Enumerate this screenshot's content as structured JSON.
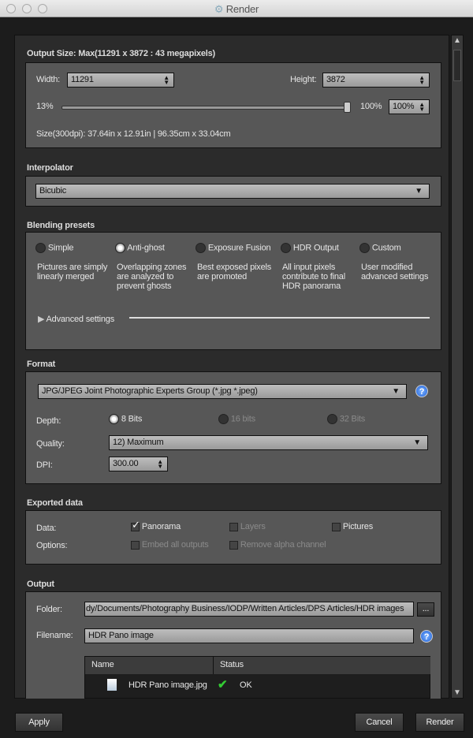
{
  "window": {
    "title": "Render"
  },
  "output_size": {
    "header": "Output Size: Max(11291 x 3872 : 43 megapixels)",
    "width_label": "Width:",
    "width": "11291",
    "height_label": "Height:",
    "height": "3872",
    "min_label": "13%",
    "max_label": "100%",
    "scale": "100%",
    "scale_percent": 100,
    "size_info": "Size(300dpi): 37.64in x 12.91in | 96.35cm x 33.04cm"
  },
  "interpolator": {
    "header": "Interpolator",
    "value": "Bicubic"
  },
  "blending": {
    "header": "Blending presets",
    "presets": [
      {
        "label": "Simple",
        "desc": "Pictures are simply linearly merged",
        "selected": false
      },
      {
        "label": "Anti-ghost",
        "desc": "Overlapping zones are analyzed to prevent ghosts",
        "selected": true
      },
      {
        "label": "Exposure Fusion",
        "desc": "Best exposed pixels are promoted",
        "selected": false
      },
      {
        "label": "HDR Output",
        "desc": "All input pixels contribute to final HDR panorama",
        "selected": false
      },
      {
        "label": "Custom",
        "desc": "User modified advanced settings",
        "selected": false
      }
    ],
    "advanced": "Advanced settings"
  },
  "format": {
    "header": "Format",
    "value": "JPG/JPEG Joint Photographic Experts Group (*.jpg *.jpeg)",
    "depth_label": "Depth:",
    "depths": [
      "8 Bits",
      "16 bits",
      "32 Bits"
    ],
    "quality_label": "Quality:",
    "quality": "12) Maximum",
    "dpi_label": "DPI:",
    "dpi": "300.00",
    "help": "?"
  },
  "exported": {
    "header": "Exported data",
    "data_label": "Data:",
    "options_label": "Options:",
    "panorama": "Panorama",
    "layers": "Layers",
    "pictures": "Pictures",
    "embed": "Embed all outputs",
    "remove_alpha": "Remove alpha channel"
  },
  "output": {
    "header": "Output",
    "folder_label": "Folder:",
    "folder": "dy/Documents/Photography Business/IODP/Written Articles/DPS Articles/HDR images",
    "browse": "...",
    "filename_label": "Filename:",
    "filename": "HDR Pano image",
    "help": "?",
    "table": {
      "columns": [
        "Name",
        "Status"
      ],
      "rows": [
        {
          "name": "HDR Pano image.jpg",
          "status": "OK"
        }
      ]
    }
  },
  "buttons": {
    "apply": "Apply",
    "cancel": "Cancel",
    "render": "Render"
  }
}
